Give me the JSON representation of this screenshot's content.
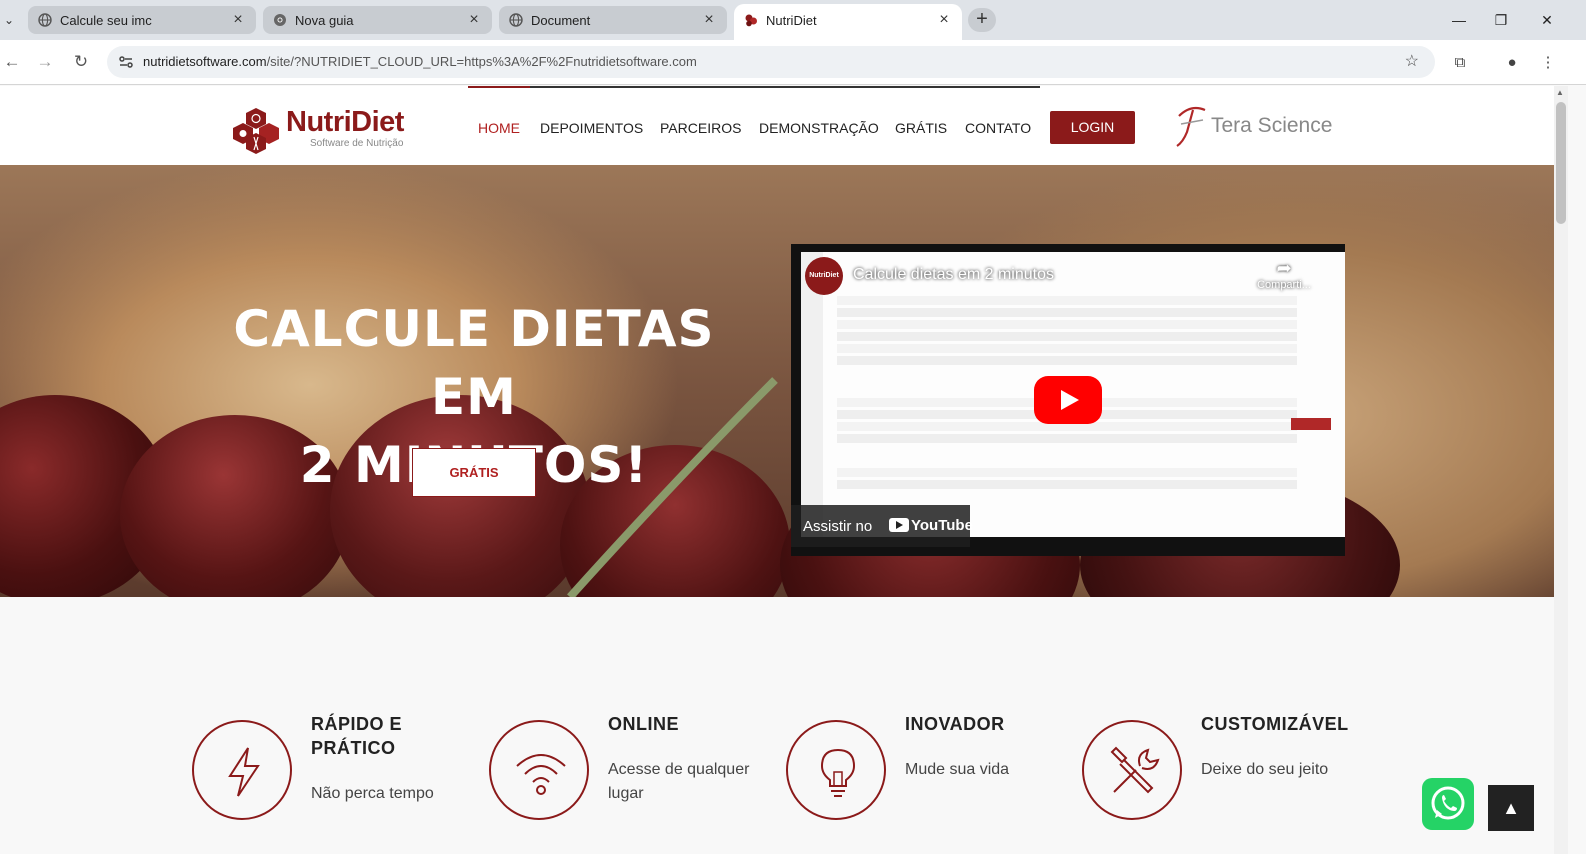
{
  "browser": {
    "tabs": [
      {
        "title": "Calcule seu imc"
      },
      {
        "title": "Nova guia"
      },
      {
        "title": "Document"
      },
      {
        "title": "NutriDiet"
      }
    ],
    "url_host": "nutridietsoftware.com",
    "url_rest": "/site/?NUTRIDIET_CLOUD_URL=https%3A%2F%2Fnutridietsoftware.com"
  },
  "header": {
    "logo_name": "NutriDiet",
    "logo_sub": "Software de Nutrição",
    "nav": [
      "HOME",
      "DEPOIMENTOS",
      "PARCEIROS",
      "DEMONSTRAÇÃO",
      "GRÁTIS",
      "CONTATO"
    ],
    "login_label": "LOGIN",
    "partner_name": "Tera Science",
    "colors": {
      "brand": "#8b1a1a",
      "active_nav": "#b02020"
    }
  },
  "hero": {
    "title_line1": "CALCULE DIETAS EM",
    "title_line2": "2 MINUTOS!",
    "cta_label": "GRÁTIS"
  },
  "video": {
    "channel_avatar": "NutriDiet",
    "title": "Calcule dietas em 2 minutos",
    "share_label": "Comparti...",
    "watch_on": "Assistir no",
    "platform": "YouTube"
  },
  "features": [
    {
      "icon": "lightning-icon",
      "title_line1": "RÁPIDO E",
      "title_line2": "PRÁTICO",
      "text_line1": "Não perca tempo",
      "text_line2": ""
    },
    {
      "icon": "wifi-icon",
      "title_line1": "ONLINE",
      "title_line2": "",
      "text_line1": "Acesse de qualquer",
      "text_line2": "lugar"
    },
    {
      "icon": "lightbulb-icon",
      "title_line1": "INOVADOR",
      "title_line2": "",
      "text_line1": "Mude sua vida",
      "text_line2": ""
    },
    {
      "icon": "tools-icon",
      "title_line1": "CUSTOMIZÁVEL",
      "title_line2": "",
      "text_line1": "Deixe do seu jeito",
      "text_line2": ""
    }
  ]
}
